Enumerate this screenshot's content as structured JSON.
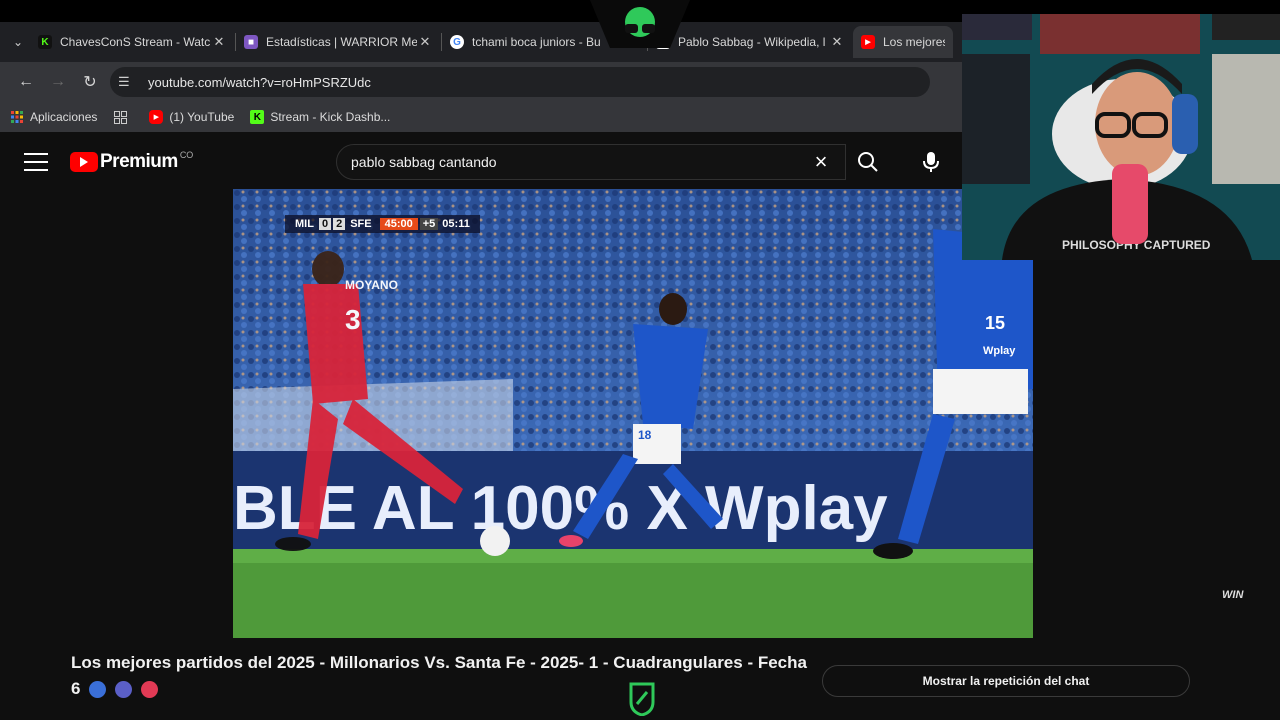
{
  "browser": {
    "tabs": [
      {
        "label": "ChavesConS Stream - Watch",
        "favicon": "kick-icon",
        "color": "#53fc18",
        "active": false
      },
      {
        "label": "Estadísticas | WARRIOR Mex",
        "favicon": "twitch-stats-icon",
        "color": "#7e57c2",
        "active": false
      },
      {
        "label": "tchami boca juniors - Bu",
        "favicon": "google-icon",
        "color": "#4285f4",
        "active": false
      },
      {
        "label": "Pablo Sabbag - Wikipedia, l",
        "favicon": "wikipedia-icon",
        "color": "#ffffff",
        "active": false
      },
      {
        "label": "Los mejores p",
        "favicon": "youtube-icon",
        "color": "#ff0000",
        "active": true
      }
    ],
    "url": "youtube.com/watch?v=roHmPSRZUdc",
    "bookmarks": [
      {
        "label": "Aplicaciones",
        "icon": "apps-grid-icon"
      },
      {
        "label": "",
        "icon": "grid-icon"
      },
      {
        "label": "(1) YouTube",
        "icon": "youtube-icon"
      },
      {
        "label": "Stream - Kick Dashb...",
        "icon": "kick-icon"
      }
    ]
  },
  "youtube": {
    "logo_text": "Premium",
    "logo_country": "CO",
    "search_query": "pablo sabbag cantando",
    "video_title": "Los mejores partidos del 2025 - Millonarios Vs. Santa Fe - 2025- 1 - Cuadrangulares - Fecha 6",
    "chat_replay_label": "Mostrar la repetición del chat"
  },
  "scorebug": {
    "home": "MIL",
    "home_score": "0",
    "away_score": "2",
    "away": "SFE",
    "clock": "45:00",
    "added": "+5",
    "added_time": "05:11"
  },
  "ad_board_text": "BLE AL 100% X Wplay",
  "broadcaster_logo": "WIN",
  "jerseys": {
    "red_player_name": "MOYANO",
    "red_player_number": "3",
    "blue_player_number": "18",
    "blue_right_number": "15",
    "blue_sponsor": "Wplay"
  },
  "webcam": {
    "shirt_text": "PHILOSOPHY CAPTURED"
  },
  "colors": {
    "accent_red": "#ff0000",
    "kick_green": "#53fc18",
    "clock_orange": "#e64a19"
  }
}
